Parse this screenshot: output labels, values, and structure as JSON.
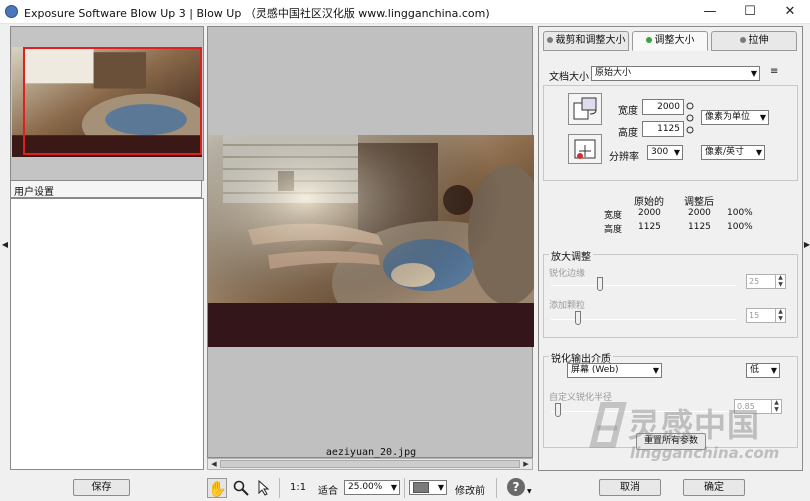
{
  "window": {
    "title": "Exposure Software Blow Up 3 | Blow Up （灵感中国社区汉化版 www.lingganchina.com)",
    "minimize": "—",
    "maximize": "☐",
    "close": "✕"
  },
  "left_panel": {
    "user_settings_label": "用户设置",
    "save_label": "保存"
  },
  "canvas": {
    "filename": "aeziyuan_20.jpg"
  },
  "tabs": [
    {
      "label": "裁剪和调整大小",
      "active": false
    },
    {
      "label": "调整大小",
      "active": true
    },
    {
      "label": "拉伸",
      "active": false
    }
  ],
  "document_size": {
    "label": "文档大小",
    "value": "原始大小"
  },
  "dimensions": {
    "width_label": "宽度",
    "width_value": "2000",
    "height_label": "高度",
    "height_value": "1125",
    "unit_value": "像素为单位",
    "resolution_label": "分辨率",
    "resolution_value": "300",
    "resolution_unit": "像素/英寸"
  },
  "summary_table": {
    "headers": [
      "原始的",
      "调整后"
    ],
    "rows": [
      {
        "label": "宽度",
        "original": "2000",
        "adjusted": "2000",
        "percent": "100%"
      },
      {
        "label": "高度",
        "original": "1125",
        "adjusted": "1125",
        "percent": "100%"
      }
    ]
  },
  "enlarge_group": {
    "title": "放大调整",
    "sharpen_edges_label": "锐化边缘",
    "sharpen_edges_value": "25",
    "add_grain_label": "添加颗粒",
    "add_grain_value": "15"
  },
  "output_group": {
    "title": "锐化输出介质",
    "medium_value": "屏幕 (Web)",
    "level_value": "低",
    "custom_radius_label": "自定义锐化半径",
    "custom_radius_value": "0.85"
  },
  "reset_all_label": "重置所有参数",
  "toolbar": {
    "ratio_label": "1:1",
    "fit_label": "适合",
    "zoom_value": "25.00%",
    "before_label": "修改前",
    "help_icon": "?"
  },
  "buttons": {
    "cancel": "取消",
    "ok": "确定"
  },
  "watermark": {
    "cn": "灵感中国",
    "en": "lingganchina.com"
  }
}
